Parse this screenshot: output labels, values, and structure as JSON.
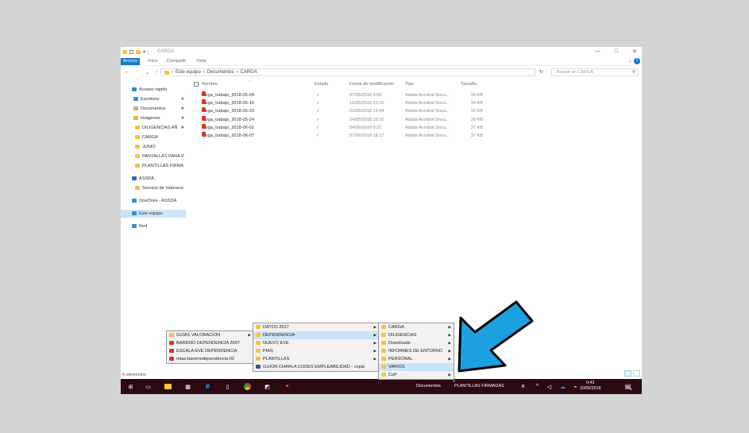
{
  "window": {
    "title": "CARGA",
    "controls": [
      "—",
      "□",
      "✕"
    ]
  },
  "ribbon": {
    "tabs": [
      "Archivo",
      "Inicio",
      "Compartir",
      "Vista"
    ],
    "help": "?",
    "collapse": "⌄"
  },
  "address": {
    "nav": [
      "←",
      "→",
      "⌄",
      "↑"
    ],
    "path": [
      "Este equipo",
      "Documentos",
      "CARGA"
    ],
    "separator": "›",
    "search_placeholder": "Buscar en CARGA",
    "refresh": "↻",
    "search_icon": "⚲"
  },
  "nav_pane": [
    {
      "label": "Acceso rápido",
      "icon": "star",
      "pinned": false
    },
    {
      "label": "Escritorio",
      "icon": "desktop",
      "pinned": true
    },
    {
      "label": "Documentos",
      "icon": "docs",
      "pinned": true
    },
    {
      "label": "Imágenes",
      "icon": "pictures",
      "pinned": true
    },
    {
      "label": "DILIGENCIAS AÑ",
      "icon": "folder",
      "pinned": true
    },
    {
      "label": "CARGA",
      "icon": "folder",
      "pinned": false
    },
    {
      "label": "JUNIO",
      "icon": "folder",
      "pinned": false
    },
    {
      "label": "PANTALLAS PARA P",
      "icon": "folder",
      "pinned": false
    },
    {
      "label": "PLANTILLAS FIRMA",
      "icon": "folder",
      "pinned": false
    },
    {
      "label": "ASSDA",
      "icon": "building",
      "pinned": false
    },
    {
      "label": "Servicio de Valoracio",
      "icon": "folder",
      "pinned": false
    },
    {
      "label": "OneDrive - ASSDA",
      "icon": "cloud",
      "pinned": false
    },
    {
      "label": "Este equipo",
      "icon": "pc",
      "pinned": false,
      "selected": true
    },
    {
      "label": "Red",
      "icon": "network",
      "pinned": false
    }
  ],
  "columns": {
    "name": "Nombre",
    "status": "Estado",
    "modified": "Fecha de modificación",
    "type": "Tipo",
    "size": "Tamaño"
  },
  "files": [
    {
      "name": "carga_trabajo_2018-05-04",
      "status": "✓",
      "modified": "07/05/2018 9:56",
      "type": "Adobe Acrobat Docu...",
      "size": "39 KB"
    },
    {
      "name": "carga_trabajo_2018-05-16",
      "status": "✓",
      "modified": "16/05/2018 23:10",
      "type": "Adobe Acrobat Docu...",
      "size": "34 KB"
    },
    {
      "name": "carga_trabajo_2018-05-23",
      "status": "✓",
      "modified": "23/05/2018 13:44",
      "type": "Adobe Acrobat Docu...",
      "size": "32 KB"
    },
    {
      "name": "carga_trabajo_2018-05-24",
      "status": "✓",
      "modified": "24/05/2018 16:31",
      "type": "Adobe Acrobat Docu...",
      "size": "30 KB"
    },
    {
      "name": "carga_trabajo_2018-06-01",
      "status": "✓",
      "modified": "04/06/2018 9:21",
      "type": "Adobe Acrobat Docu...",
      "size": "37 KB"
    },
    {
      "name": "carga_trabajo_2018-06-07",
      "status": "✓",
      "modified": "07/06/2018 18:17",
      "type": "Adobe Acrobat Docu...",
      "size": "37 KB"
    }
  ],
  "status_bar": "6 elementos",
  "menus": {
    "left": [
      {
        "label": "GUIAS VALORACION",
        "icon": "folder",
        "submenu": true
      },
      {
        "label": "BAREMO DEPENDENCIA 2007",
        "icon": "pdf",
        "submenu": false
      },
      {
        "label": "ESCALA EVE DEPENDENCIA",
        "icon": "pdf",
        "submenu": false
      },
      {
        "label": "mtas-baremodependencia-02",
        "icon": "pdf",
        "submenu": false
      }
    ],
    "middle": [
      {
        "label": "DATOS 2017",
        "icon": "folder",
        "submenu": true
      },
      {
        "label": "DEPENDENCIA",
        "icon": "folder",
        "submenu": true,
        "highlighted": true
      },
      {
        "label": "NUEVO EVE",
        "icon": "folder",
        "submenu": true
      },
      {
        "label": "PIAS",
        "icon": "folder",
        "submenu": true
      },
      {
        "label": "PLANTILLAS",
        "icon": "folder",
        "submenu": true
      },
      {
        "label": "GUION CHARLA CODES EMPLEABILIDAD - copia",
        "icon": "doc",
        "submenu": false
      }
    ],
    "right": [
      {
        "label": "CARGA",
        "icon": "folder",
        "submenu": true
      },
      {
        "label": "DILIGENCIAS",
        "icon": "folder",
        "submenu": true
      },
      {
        "label": "Downloads",
        "icon": "folder",
        "submenu": true
      },
      {
        "label": "INFORMES DE ENTORNO",
        "icon": "folder",
        "submenu": true
      },
      {
        "label": "PERSONAL",
        "icon": "folder",
        "submenu": true
      },
      {
        "label": "VARIOS",
        "icon": "folder",
        "submenu": false,
        "highlighted": true
      },
      {
        "label": "CoP",
        "icon": "folder",
        "submenu": true
      }
    ]
  },
  "taskbar": {
    "toolbar_documentos": "Documentos",
    "toolbar_plantillas": "PLANTILLAS FIRMADAS",
    "overflow": "»",
    "time": "0:43",
    "date": "10/06/2018",
    "notification_count": "1"
  },
  "colors": {
    "accent": "#1979ca",
    "taskbar": "#2b0a11",
    "folder": "#f3c43d",
    "pdf": "#d9342b",
    "sync_ok": "#3ea84b",
    "arrow": "#1ba1e2"
  }
}
